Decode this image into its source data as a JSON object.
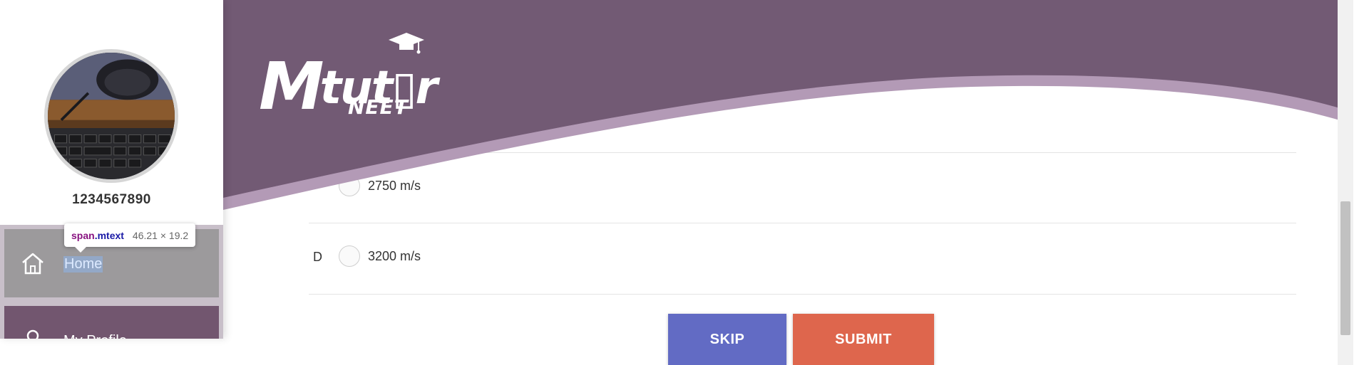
{
  "app": {
    "logo_text_main": "tut",
    "logo_text_m": "M",
    "logo_text_end": "r",
    "logo_sub": "NEET"
  },
  "colors": {
    "header": "#725a74",
    "wave_light": "#b39ab6",
    "skip_button": "#626bc4",
    "submit_button": "#de664d",
    "menu_active": "#9c9a9c",
    "menu_normal": "#72566f"
  },
  "sidebar": {
    "phone": "1234567890",
    "menu": [
      {
        "label": "Home",
        "icon": "home-icon"
      },
      {
        "label": "My Profile",
        "icon": "user-icon"
      }
    ]
  },
  "devtools_tooltip": {
    "tag": "span",
    "class": ".mtext",
    "dims": "46.21 × 19.2"
  },
  "question": {
    "options": [
      {
        "letter": "",
        "text": "2750 m/s"
      },
      {
        "letter": "D",
        "text": "3200 m/s"
      }
    ]
  },
  "actions": {
    "skip_label": "SKIP",
    "submit_label": "SUBMIT"
  }
}
